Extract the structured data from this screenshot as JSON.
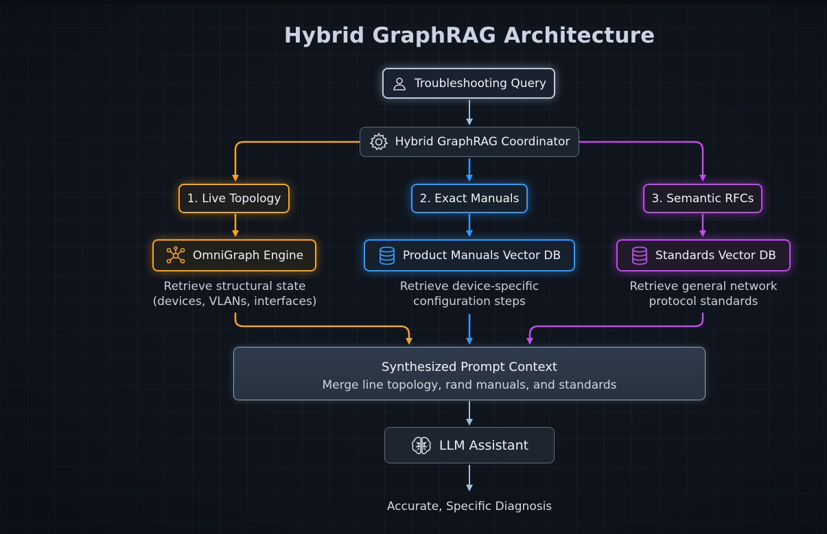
{
  "title": "Hybrid GraphRAG Architecture",
  "colors": {
    "topology": "#f5a623",
    "manuals": "#2f9bff",
    "standards": "#c34cf0",
    "neutral": "#8fb3d6"
  },
  "nodes": {
    "query": {
      "label": "Troubleshooting Query",
      "icon": "user-icon"
    },
    "coordinator": {
      "label": "Hybrid GraphRAG Coordinator",
      "icon": "gear-icon"
    },
    "live_topology": {
      "label": "1. Live Topology"
    },
    "exact_manuals": {
      "label": "2. Exact Manuals"
    },
    "semantic_rfcs": {
      "label": "3. Semantic RFCs"
    },
    "omnigraph": {
      "label": "OmniGraph Engine",
      "icon": "graph-network-icon",
      "description": [
        "Retrieve structural state",
        "(devices, VLANs, interfaces)"
      ]
    },
    "product_manuals_db": {
      "label": "Product Manuals Vector DB",
      "icon": "database-icon",
      "description": [
        "Retrieve device-specific",
        "configuration steps"
      ]
    },
    "standards_db": {
      "label": "Standards Vector DB",
      "icon": "database-icon",
      "description": [
        "Retrieve general network",
        "protocol standards"
      ]
    },
    "synthesized": {
      "title": "Synthesized Prompt Context",
      "subtitle": "Merge line topology, rand manuals, and standards"
    },
    "llm": {
      "label": "LLM Assistant",
      "icon": "brain-icon"
    }
  },
  "output": "Accurate, Specific Diagnosis"
}
